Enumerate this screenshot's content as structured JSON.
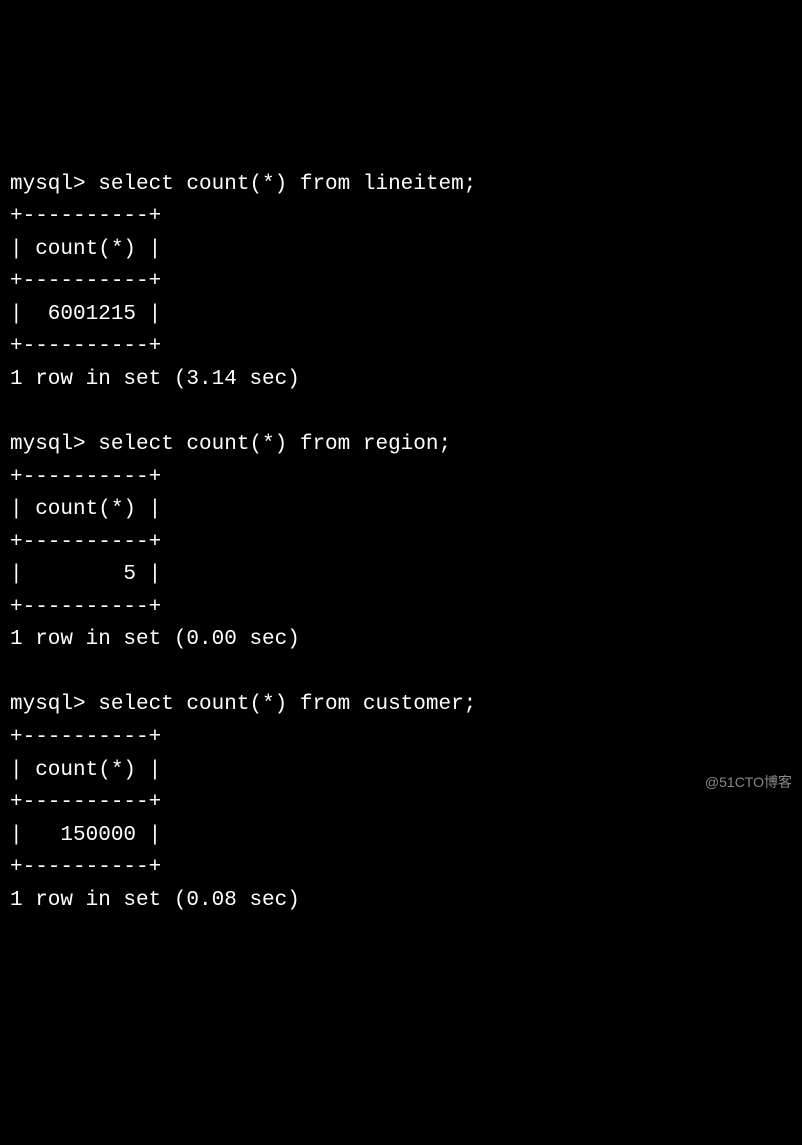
{
  "queries": [
    {
      "prompt": "mysql> ",
      "command": "select count(*) from lineitem;",
      "border": "+----------+",
      "header": "| count(*) |",
      "value_row": "|  6001215 |",
      "summary": "1 row in set (3.14 sec)"
    },
    {
      "prompt": "mysql> ",
      "command": "select count(*) from region;",
      "border": "+----------+",
      "header": "| count(*) |",
      "value_row": "|        5 |",
      "summary": "1 row in set (0.00 sec)"
    },
    {
      "prompt": "mysql> ",
      "command": "select count(*) from customer;",
      "border": "+----------+",
      "header": "| count(*) |",
      "value_row": "|   150000 |",
      "summary": "1 row in set (0.08 sec)"
    }
  ],
  "watermark": "@51CTO博客"
}
